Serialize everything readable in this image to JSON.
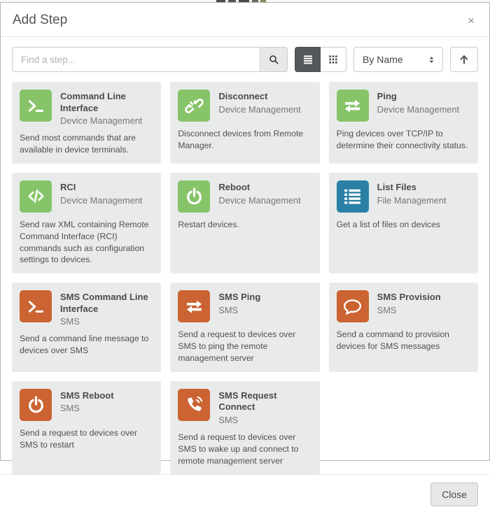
{
  "modal": {
    "title": "Add Step",
    "close_icon": "×"
  },
  "toolbar": {
    "search": {
      "placeholder": "Find a step...",
      "value": "",
      "icon": "search-icon"
    },
    "view_toggle": {
      "active": "list",
      "list_icon": "list-view-icon",
      "grid_icon": "grid-view-icon"
    },
    "sort_select": {
      "value": "By Name",
      "icon": "sort-arrows-icon"
    },
    "sort_direction": {
      "icon": "arrow-up-icon"
    }
  },
  "colors": {
    "device_management": "#87c469",
    "file_management": "#2b81a5",
    "sms": "#cb6332",
    "active_toggle": "#54585a",
    "card_background": "#e9ebeb"
  },
  "steps": [
    {
      "title": "Command Line Interface",
      "category": "Device Management",
      "description": "Send most commands that are available in device terminals.",
      "icon": "terminal-icon",
      "color": "#87c469"
    },
    {
      "title": "Disconnect",
      "category": "Device Management",
      "description": "Disconnect devices from Remote Manager.",
      "icon": "broken-link-icon",
      "color": "#87c469"
    },
    {
      "title": "Ping",
      "category": "Device Management",
      "description": "Ping devices over TCP/IP to determine their connectivity status.",
      "icon": "exchange-arrows-icon",
      "color": "#87c469"
    },
    {
      "title": "RCI",
      "category": "Device Management",
      "description": "Send raw XML containing Remote Command Interface (RCI) commands such as configuration settings to devices.",
      "icon": "code-icon",
      "color": "#87c469"
    },
    {
      "title": "Reboot",
      "category": "Device Management",
      "description": "Restart devices.",
      "icon": "power-icon",
      "color": "#87c469"
    },
    {
      "title": "List Files",
      "category": "File Management",
      "description": "Get a list of files on devices",
      "icon": "list-icon",
      "color": "#2b81a5"
    },
    {
      "title": "SMS Command Line Interface",
      "category": "SMS",
      "description": "Send a command line message to devices over SMS",
      "icon": "terminal-icon",
      "color": "#cb6332"
    },
    {
      "title": "SMS Ping",
      "category": "SMS",
      "description": "Send a request to devices over SMS to ping the remote management server",
      "icon": "exchange-arrows-icon",
      "color": "#cb6332"
    },
    {
      "title": "SMS Provision",
      "category": "SMS",
      "description": "Send a command to provision devices for SMS messages",
      "icon": "comment-icon",
      "color": "#cb6332"
    },
    {
      "title": "SMS Reboot",
      "category": "SMS",
      "description": "Send a request to devices over SMS to restart",
      "icon": "power-icon",
      "color": "#cb6332"
    },
    {
      "title": "SMS Request Connect",
      "category": "SMS",
      "description": "Send a request to devices over SMS to wake up and connect to remote management server",
      "icon": "phone-volume-icon",
      "color": "#cb6332"
    }
  ],
  "footer": {
    "close_label": "Close"
  }
}
